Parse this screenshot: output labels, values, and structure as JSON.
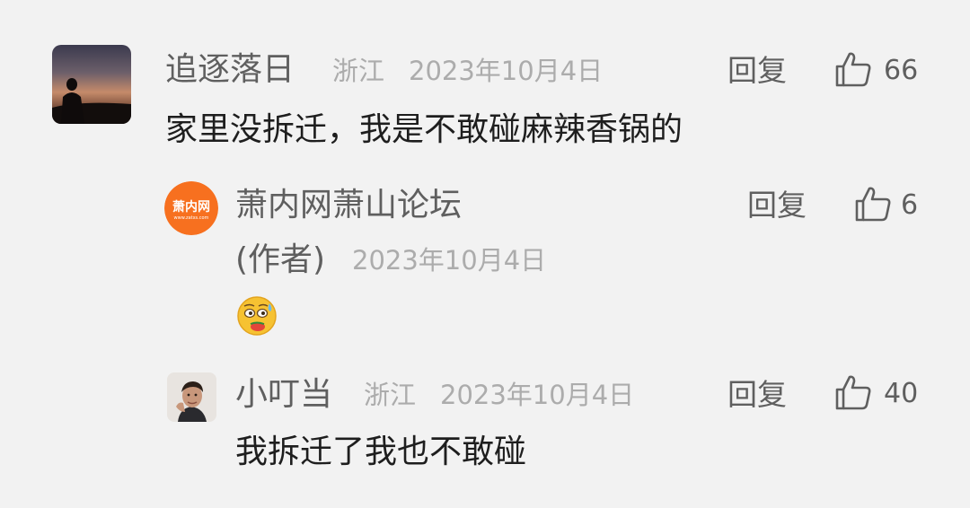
{
  "comments": [
    {
      "username": "追逐落日",
      "location": "浙江",
      "date": "2023年10月4日",
      "text": "家里没拆迁，我是不敢碰麻辣香锅的",
      "reply_label": "回复",
      "likes": "66",
      "replies": [
        {
          "username": "萧内网萧山论坛",
          "author_tag": "(作者)",
          "date": "2023年10月4日",
          "text": "",
          "emoji": "embarrassed-sweat-emoji",
          "reply_label": "回复",
          "likes": "6",
          "avatar_logo_text": "萧内网",
          "avatar_logo_sub": "www.zatxs.com",
          "avatar_color": "#f7701f"
        },
        {
          "username": "小叮当",
          "location": "浙江",
          "date": "2023年10月4日",
          "text": "我拆迁了我也不敢碰",
          "reply_label": "回复",
          "likes": "40"
        }
      ]
    }
  ],
  "colors": {
    "background": "#f2f2f2",
    "username": "#5f5f5f",
    "meta": "#acacac",
    "body": "#1e1e1e"
  },
  "icons": {
    "like": "thumbs-up-outline-icon"
  }
}
